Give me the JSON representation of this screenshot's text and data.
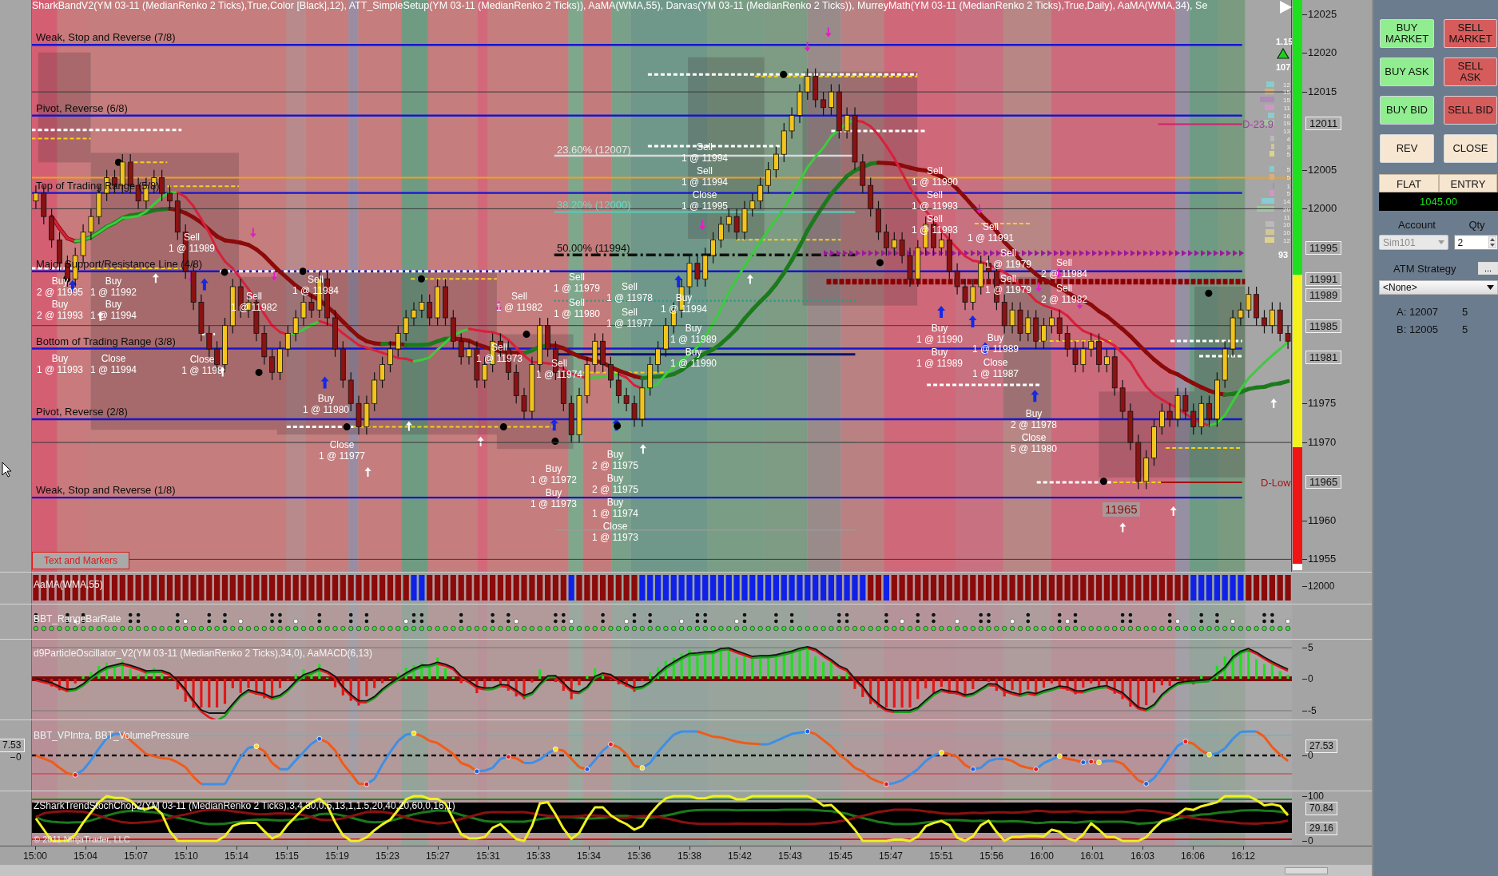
{
  "chart": {
    "header": "SharkBandV2(YM 03-11 (MedianRenko 2 Ticks),True,Color [Black],12), ATT_SimpleSetup(YM 03-11 (MedianRenko 2 Ticks)), AaMA(WMA,55), Darvas(YM 03-11 (MedianRenko 2 Ticks)), MurreyMath(YM 03-11 (MedianRenko 2 Ticks),True,Daily), AaMA(WMA,34), Se",
    "chart_data": [
      {
        "type": "candlestick",
        "grid": true,
        "ylim": [
          11953.4,
          12026.8
        ],
        "yticks": [
          12025,
          12020,
          12015,
          12005,
          12000,
          11975,
          11970,
          11960,
          11955
        ],
        "ohlc": [
          [
            12001,
            12003,
            12000,
            12002
          ],
          [
            12002,
            12003,
            11998,
            11999
          ],
          [
            11999,
            12000,
            11995,
            11996
          ],
          [
            11996,
            11997,
            11992,
            11993
          ],
          [
            11993,
            11994,
            11990,
            11991
          ],
          [
            11991,
            11995,
            11990,
            11994
          ],
          [
            11994,
            11998,
            11993,
            11997
          ],
          [
            11997,
            12000,
            11996,
            11999
          ],
          [
            11999,
            12003,
            11998,
            12002
          ],
          [
            12002,
            12005,
            12001,
            12004
          ],
          [
            12004,
            12005,
            12002,
            12003
          ],
          [
            12003,
            12007,
            12002,
            12006
          ],
          [
            12006,
            12007,
            12002,
            12003
          ],
          [
            12003,
            12004,
            12000,
            12001
          ],
          [
            12001,
            12004,
            12000,
            12003
          ],
          [
            12003,
            12005,
            12002,
            12004
          ],
          [
            12004,
            12005,
            12001,
            12002
          ],
          [
            12002,
            12003,
            12000,
            12001
          ],
          [
            12001,
            12002,
            11996,
            11997
          ],
          [
            11997,
            11998,
            11991,
            11992
          ],
          [
            11992,
            11993,
            11987,
            11988
          ],
          [
            11988,
            11989,
            11983,
            11984
          ],
          [
            11984,
            11985,
            11981,
            11982
          ],
          [
            11982,
            11983,
            11979,
            11980
          ],
          [
            11980,
            11986,
            11979,
            11985
          ],
          [
            11985,
            11991,
            11984,
            11990
          ],
          [
            11990,
            11991,
            11986,
            11987
          ],
          [
            11987,
            11989,
            11986,
            11988
          ],
          [
            11988,
            11989,
            11983,
            11984
          ],
          [
            11984,
            11985,
            11980,
            11981
          ],
          [
            11981,
            11982,
            11978,
            11979
          ],
          [
            11979,
            11983,
            11978,
            11982
          ],
          [
            11982,
            11985,
            11981,
            11984
          ],
          [
            11984,
            11987,
            11983,
            11986
          ],
          [
            11986,
            11989,
            11985,
            11988
          ],
          [
            11988,
            11989,
            11986,
            11987
          ],
          [
            11987,
            11992,
            11986,
            11991
          ],
          [
            11991,
            11992,
            11985,
            11986
          ],
          [
            11986,
            11987,
            11981,
            11982
          ],
          [
            11982,
            11983,
            11977,
            11978
          ],
          [
            11978,
            11979,
            11974,
            11975
          ],
          [
            11975,
            11976,
            11971,
            11972
          ],
          [
            11972,
            11976,
            11971,
            11975
          ],
          [
            11975,
            11979,
            11974,
            11978
          ],
          [
            11978,
            11981,
            11977,
            11980
          ],
          [
            11980,
            11983,
            11979,
            11982
          ],
          [
            11982,
            11985,
            11981,
            11984
          ],
          [
            11984,
            11987,
            11983,
            11986
          ],
          [
            11986,
            11988,
            11985,
            11987
          ],
          [
            11987,
            11989,
            11986,
            11988
          ],
          [
            11988,
            11989,
            11985,
            11986
          ],
          [
            11986,
            11991,
            11985,
            11990
          ],
          [
            11990,
            11991,
            11985,
            11986
          ],
          [
            11986,
            11987,
            11982,
            11983
          ],
          [
            11983,
            11984,
            11980,
            11981
          ],
          [
            11981,
            11983,
            11980,
            11982
          ],
          [
            11982,
            11983,
            11977,
            11978
          ],
          [
            11978,
            11981,
            11977,
            11980
          ],
          [
            11980,
            11984,
            11979,
            11983
          ],
          [
            11983,
            11984,
            11981,
            11982
          ],
          [
            11982,
            11983,
            11978,
            11979
          ],
          [
            11979,
            11980,
            11975,
            11976
          ],
          [
            11976,
            11977,
            11973,
            11974
          ],
          [
            11974,
            11981,
            11973,
            11980
          ],
          [
            11980,
            11986,
            11979,
            11985
          ],
          [
            11985,
            11986,
            11981,
            11982
          ],
          [
            11982,
            11983,
            11978,
            11979
          ],
          [
            11979,
            11980,
            11974,
            11975
          ],
          [
            11975,
            11976,
            11970,
            11971
          ],
          [
            11971,
            11977,
            11970,
            11976
          ],
          [
            11976,
            11981,
            11975,
            11980
          ],
          [
            11980,
            11984,
            11979,
            11983
          ],
          [
            11983,
            11984,
            11979,
            11980
          ],
          [
            11980,
            11981,
            11977,
            11978
          ],
          [
            11978,
            11979,
            11975,
            11976
          ],
          [
            11976,
            11977,
            11974,
            11975
          ],
          [
            11975,
            11976,
            11972,
            11973
          ],
          [
            11973,
            11978,
            11972,
            11977
          ],
          [
            11977,
            11981,
            11976,
            11980
          ],
          [
            11980,
            11983,
            11979,
            11982
          ],
          [
            11982,
            11986,
            11981,
            11985
          ],
          [
            11985,
            11988,
            11984,
            11987
          ],
          [
            11987,
            11991,
            11986,
            11990
          ],
          [
            11990,
            11994,
            11989,
            11993
          ],
          [
            11993,
            11994,
            11990,
            11991
          ],
          [
            11991,
            11995,
            11990,
            11994
          ],
          [
            11994,
            11997,
            11993,
            11996
          ],
          [
            11996,
            11999,
            11995,
            11998
          ],
          [
            11998,
            12000,
            11997,
            11999
          ],
          [
            11999,
            12000,
            11996,
            11997
          ],
          [
            11997,
            12001,
            11996,
            12000
          ],
          [
            12000,
            12002,
            11999,
            12001
          ],
          [
            12001,
            12004,
            12000,
            12003
          ],
          [
            12003,
            12006,
            12002,
            12005
          ],
          [
            12005,
            12008,
            12004,
            12007
          ],
          [
            12007,
            12011,
            12006,
            12010
          ],
          [
            12010,
            12013,
            12009,
            12012
          ],
          [
            12012,
            12016,
            12011,
            12015
          ],
          [
            12015,
            12018,
            12014,
            12017
          ],
          [
            12017,
            12018,
            12013,
            12014
          ],
          [
            12014,
            12015,
            12012,
            12013
          ],
          [
            12013,
            12016,
            12012,
            12015
          ],
          [
            12015,
            12016,
            12009,
            12010
          ],
          [
            12010,
            12013,
            12009,
            12012
          ],
          [
            12012,
            12013,
            12005,
            12006
          ],
          [
            12006,
            12007,
            12002,
            12003
          ],
          [
            12003,
            12004,
            11999,
            12000
          ],
          [
            12000,
            12001,
            11996,
            11997
          ],
          [
            11997,
            11998,
            11994,
            11995
          ],
          [
            11995,
            11997,
            11994,
            11996
          ],
          [
            11996,
            11997,
            11993,
            11994
          ],
          [
            11994,
            11995,
            11990,
            11991
          ],
          [
            11991,
            11996,
            11990,
            11995
          ],
          [
            11995,
            11999,
            11994,
            11998
          ],
          [
            11998,
            11999,
            11994,
            11995
          ],
          [
            11995,
            11997,
            11994,
            11996
          ],
          [
            11996,
            11997,
            11991,
            11992
          ],
          [
            11992,
            11993,
            11989,
            11990
          ],
          [
            11990,
            11991,
            11987,
            11988
          ],
          [
            11988,
            11991,
            11987,
            11990
          ],
          [
            11990,
            11994,
            11989,
            11993
          ],
          [
            11993,
            11994,
            11991,
            11992
          ],
          [
            11992,
            11993,
            11987,
            11988
          ],
          [
            11988,
            11989,
            11984,
            11985
          ],
          [
            11985,
            11988,
            11984,
            11987
          ],
          [
            11987,
            11988,
            11983,
            11984
          ],
          [
            11984,
            11987,
            11983,
            11986
          ],
          [
            11986,
            11987,
            11982,
            11983
          ],
          [
            11983,
            11986,
            11982,
            11985
          ],
          [
            11985,
            11987,
            11984,
            11986
          ],
          [
            11986,
            11987,
            11983,
            11984
          ],
          [
            11984,
            11985,
            11981,
            11982
          ],
          [
            11982,
            11983,
            11979,
            11980
          ],
          [
            11980,
            11983,
            11979,
            11982
          ],
          [
            11982,
            11984,
            11981,
            11983
          ],
          [
            11983,
            11984,
            11979,
            11980
          ],
          [
            11980,
            11982,
            11979,
            11981
          ],
          [
            11981,
            11982,
            11976,
            11977
          ],
          [
            11977,
            11978,
            11973,
            11974
          ],
          [
            11974,
            11975,
            11969,
            11970
          ],
          [
            11970,
            11971,
            11964,
            11965
          ],
          [
            11965,
            11969,
            11964,
            11968
          ],
          [
            11968,
            11973,
            11967,
            11972
          ],
          [
            11972,
            11975,
            11971,
            11974
          ],
          [
            11974,
            11975,
            11972,
            11973
          ],
          [
            11973,
            11977,
            11972,
            11976
          ],
          [
            11976,
            11977,
            11973,
            11974
          ],
          [
            11974,
            11975,
            11971,
            11972
          ],
          [
            11972,
            11976,
            11971,
            11975
          ],
          [
            11975,
            11976,
            11972,
            11973
          ],
          [
            11973,
            11979,
            11972,
            11978
          ],
          [
            11978,
            11983,
            11977,
            11982
          ],
          [
            11982,
            11987,
            11981,
            11986
          ],
          [
            11986,
            11988,
            11985,
            11987
          ],
          [
            11987,
            11990,
            11986,
            11989
          ],
          [
            11989,
            11990,
            11985,
            11986
          ],
          [
            11986,
            11987,
            11984,
            11985
          ],
          [
            11985,
            11988,
            11984,
            11987
          ],
          [
            11987,
            11988,
            11983,
            11984
          ],
          [
            11984,
            11985,
            11982,
            11983
          ]
        ]
      }
    ],
    "murrey_levels": [
      "Weak, Stop and Reverse (7/8)",
      "Pivot, Reverse (6/8)",
      "Top of Trading Range (5/8)",
      "Major Support/Resistance Line (4/8)",
      "Bottom of Trading Range (3/8)",
      "Pivot, Reverse (2/8)",
      "Weak, Stop and Reverse (1/8)"
    ],
    "fib_levels": [
      "23.60% (12007)",
      "38.20% (12000)",
      "50.00% (11994)"
    ],
    "trade_markers": [
      {
        "action": "Buy",
        "fill": "2 @ 11995"
      },
      {
        "action": "Buy",
        "fill": "1 @ 11992"
      },
      {
        "action": "Buy",
        "fill": "2 @ 11993"
      },
      {
        "action": "Buy",
        "fill": "1 @ 11994"
      },
      {
        "action": "Buy",
        "fill": "1 @ 11993"
      },
      {
        "action": "Close",
        "fill": "1 @ 11994"
      },
      {
        "action": "Sell",
        "fill": "1 @ 11989"
      },
      {
        "action": "Close",
        "fill": "1 @ 1198"
      },
      {
        "action": "Sell",
        "fill": "1 @ 11982"
      },
      {
        "action": "Sell",
        "fill": "1 @ 11984"
      },
      {
        "action": "Buy",
        "fill": "1 @ 11980"
      },
      {
        "action": "Close",
        "fill": "1 @ 11977"
      },
      {
        "action": "Sell",
        "fill": "1 @ 11979"
      },
      {
        "action": "Sell",
        "fill": "1 @ 11982"
      },
      {
        "action": "Sell",
        "fill": "1 @ 11980"
      },
      {
        "action": "Sell",
        "fill": "1 @ 11973"
      },
      {
        "action": "Sell",
        "fill": "1 @ 11974"
      },
      {
        "action": "Buy",
        "fill": "1 @ 11972"
      },
      {
        "action": "Buy",
        "fill": "1 @ 11973"
      },
      {
        "action": "Sell",
        "fill": "1 @ 11978"
      },
      {
        "action": "Sell",
        "fill": "1 @ 11977"
      },
      {
        "action": "Buy",
        "fill": "2 @ 11975"
      },
      {
        "action": "Buy",
        "fill": "2 @ 11975"
      },
      {
        "action": "Buy",
        "fill": "1 @ 11974"
      },
      {
        "action": "Close",
        "fill": "1 @ 11973"
      },
      {
        "action": "Sell",
        "fill": "1 @ 11994"
      },
      {
        "action": "Sell",
        "fill": "1 @ 11994"
      },
      {
        "action": "Close",
        "fill": "1 @ 11995"
      },
      {
        "action": "Buy",
        "fill": "1 @ 11994"
      },
      {
        "action": "Buy",
        "fill": "1 @ 11989"
      },
      {
        "action": "Buy",
        "fill": "1 @ 11990"
      },
      {
        "action": "Sell",
        "fill": "1 @ 11990"
      },
      {
        "action": "Sell",
        "fill": "1 @ 11993"
      },
      {
        "action": "Sell",
        "fill": "1 @ 11993"
      },
      {
        "action": "Buy",
        "fill": "1 @ 11990"
      },
      {
        "action": "Buy",
        "fill": "1 @ 11989"
      },
      {
        "action": "Sell",
        "fill": "1 @ 11991"
      },
      {
        "action": "Sell",
        "fill": "1 @ 11979"
      },
      {
        "action": "Sell",
        "fill": "2 @ 11984"
      },
      {
        "action": "Sell",
        "fill": "1 @ 11979"
      },
      {
        "action": "Sell",
        "fill": "2 @ 11982"
      },
      {
        "action": "Buy",
        "fill": "1 @ 11989"
      },
      {
        "action": "Close",
        "fill": "1 @ 11987"
      },
      {
        "action": "Buy",
        "fill": "2 @ 11978"
      },
      {
        "action": "Close",
        "fill": "5 @ 11980"
      }
    ],
    "level_tags": [
      "D-23.9",
      "D-Low"
    ],
    "low_tag": "11965",
    "profile": {
      "ratio": "1.15",
      "volume": "107",
      "counts": [
        "12",
        "15",
        "15",
        "11",
        "16",
        "19",
        "13",
        "4",
        "3",
        "5",
        "5",
        "5",
        "1",
        "5",
        "14",
        "20",
        "11",
        "10",
        "10",
        "12"
      ],
      "total": "93"
    },
    "markers_button": "Text and Markers",
    "price_markers": [
      "12011",
      "11995",
      "11991",
      "11989",
      "11985",
      "11981",
      "11965"
    ]
  },
  "panes": [
    {
      "kind": "bars",
      "title": "AaMA(WMA,55)",
      "axis": [
        {
          "label": "12000",
          "kind": "tick"
        }
      ]
    },
    {
      "kind": "dots",
      "title": "BBT_RangeBarRate"
    },
    {
      "kind": "oscillator",
      "title": "d9ParticleOscillator_V2(YM 03-11 (MedianRenko 2 Ticks),34,0), AaMACD(6,13)",
      "axis": [
        {
          "label": "5",
          "kind": "tick"
        },
        {
          "label": "0",
          "kind": "tick"
        },
        {
          "label": "-5",
          "kind": "tick"
        }
      ]
    },
    {
      "kind": "wave",
      "title": "BBT_VPIntra, BBT_VolumePressure",
      "left_axis": [
        {
          "label": "7.53",
          "kind": "marker"
        },
        {
          "label": "0",
          "kind": "tick"
        }
      ],
      "axis": [
        {
          "label": "27.53",
          "kind": "marker"
        },
        {
          "label": "0",
          "kind": "tick"
        }
      ]
    },
    {
      "kind": "stoch",
      "title": "ZSharkTrendStochChop2(YM 03-11 (MedianRenko 2 Ticks),3,4,30,0.5,13,1,1.5,20,40,20,60,0,16,1)",
      "axis": [
        {
          "label": "100",
          "kind": "tick"
        },
        {
          "label": "70.84",
          "kind": "marker"
        },
        {
          "label": "29.16",
          "kind": "marker"
        },
        {
          "label": "0",
          "kind": "tick"
        }
      ],
      "note": "© 2011 NinjaTrader, LLC"
    }
  ],
  "time_axis": [
    "15:00",
    "15:04",
    "15:07",
    "15:10",
    "15:14",
    "15:15",
    "15:19",
    "15:23",
    "15:27",
    "15:31",
    "15:33",
    "15:34",
    "15:36",
    "15:38",
    "15:42",
    "15:43",
    "15:45",
    "15:47",
    "15:51",
    "15:56",
    "16:00",
    "16:01",
    "16:03",
    "16:06",
    "16:12"
  ],
  "order_panel": {
    "buttons": [
      {
        "label": "BUY MARKET",
        "kind": "buy"
      },
      {
        "label": "SELL MARKET",
        "kind": "sell"
      },
      {
        "label": "BUY ASK",
        "kind": "buy"
      },
      {
        "label": "SELL ASK",
        "kind": "sell"
      },
      {
        "label": "BUY BID",
        "kind": "buy"
      },
      {
        "label": "SELL BID",
        "kind": "sell"
      },
      {
        "label": "REV",
        "kind": "neutral"
      },
      {
        "label": "CLOSE",
        "kind": "neutral"
      }
    ],
    "position": "FLAT",
    "entry": "ENTRY",
    "pnl": "1045.00",
    "account_label": "Account",
    "qty_label": "Qty",
    "account": {
      "value": "Sim101",
      "disabled": true
    },
    "qty": "2",
    "atm_label": "ATM Strategy",
    "atm_button": "...",
    "atm_strategy": "<None>",
    "quotes": [
      {
        "price": "A: 12007",
        "size": "5"
      },
      {
        "price": "B: 12005",
        "size": "5"
      }
    ]
  }
}
